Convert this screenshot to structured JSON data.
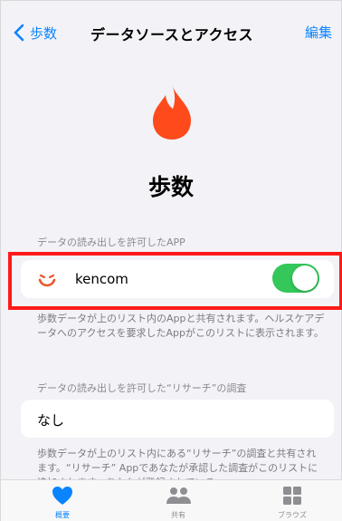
{
  "nav": {
    "back_label": "歩数",
    "title": "データソースとアクセス",
    "edit_label": "編集"
  },
  "hero": {
    "title": "歩数",
    "icon": "flame-icon",
    "icon_color": "#ff4a1c"
  },
  "read_access": {
    "header": "データの読み出しを許可したAPP",
    "apps": [
      {
        "name": "kencom",
        "icon": "kencom-smile-icon",
        "enabled": true
      }
    ],
    "footer": "歩数データが上のリスト内のAppと共有されます。ヘルスケアデータへのアクセスを要求したAppがこのリストに表示されます。"
  },
  "research": {
    "header": "データの読み出しを許可した“リサーチ”の調査",
    "value": "なし",
    "footer": "歩数データが上のリスト内にある“リサーチ”の調査と共有されます。“リサーチ” Appであなたが承認した調査がこのリストに追加されます。あなたが登録されている"
  },
  "tabbar": {
    "tabs": [
      {
        "label": "概要",
        "icon": "heart-icon",
        "active": true
      },
      {
        "label": "共有",
        "icon": "people-icon",
        "active": false
      },
      {
        "label": "ブラウズ",
        "icon": "grid-icon",
        "active": false
      }
    ]
  },
  "colors": {
    "accent": "#0a84ff",
    "toggle_on": "#34c759",
    "highlight": "#ff1a1a"
  }
}
